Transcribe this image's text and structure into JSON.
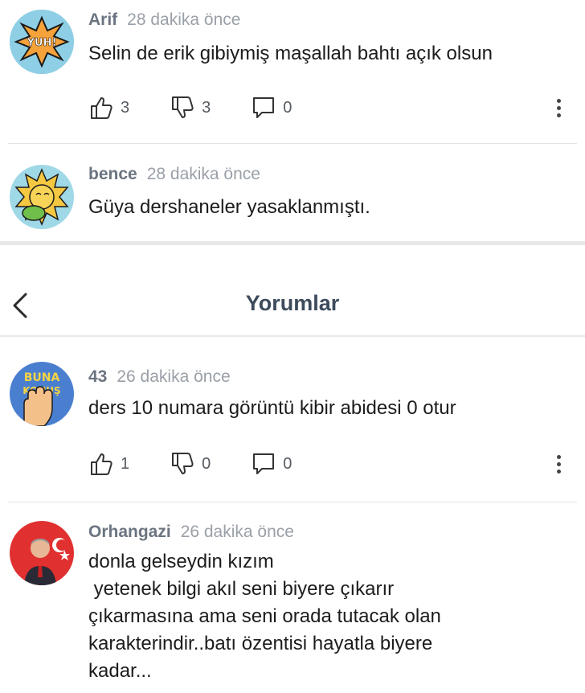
{
  "page_title": "Yorumlar",
  "comments_top": [
    {
      "author": "Arif",
      "time": "28 dakika önce",
      "text": "Selin de erik gibiymiş maşallah bahtı açık olsun",
      "avatar_label": "YUH!",
      "likes": "3",
      "dislikes": "3",
      "replies": "0"
    },
    {
      "author": "bence",
      "time": "28 dakika önce",
      "text": "Güya dershaneler yasaklanmıştı."
    }
  ],
  "comments": [
    {
      "author": "43",
      "time": "26 dakika önce",
      "text": "ders 10 numara görüntü kibir abidesi 0 otur",
      "avatar_label_1": "BUNA",
      "avatar_label_2": "KONUŞ",
      "likes": "1",
      "dislikes": "0",
      "replies": "0"
    },
    {
      "author": "Orhangazi",
      "time": "26 dakika önce",
      "text": "donla gelseydin kızım\n yetenek bilgi akıl seni biyere çıkarır\nçıkarmasına ama seni orada tutacak olan\nkarakterindir..batı özentisi hayatla biyere\nkadar..."
    }
  ],
  "colors": {
    "accent_title": "#3d4b5c",
    "author": "#6b7480",
    "time": "#9aa0a8"
  },
  "icons": [
    "thumbs-up-icon",
    "thumbs-down-icon",
    "comment-icon",
    "more-vertical-icon",
    "chevron-left-icon"
  ]
}
